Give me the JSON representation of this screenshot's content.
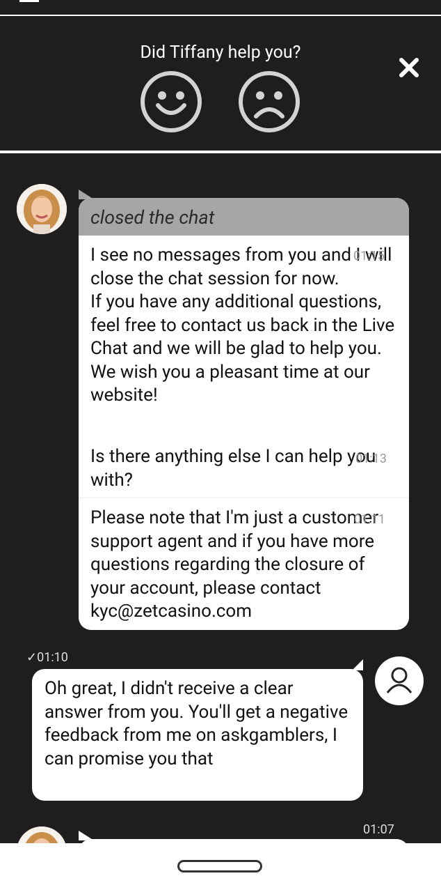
{
  "feedback": {
    "title": "Did Tiffany help you?",
    "close_icon": "close-icon",
    "happy_icon": "smiley-happy-icon",
    "sad_icon": "smiley-sad-icon"
  },
  "agent_thread": {
    "status": "closed the chat",
    "messages": [
      {
        "text": "I see no messages from you and I will close the chat session for now.\nIf you have any additional questions, feel free to contact us back in the Live Chat and we will be glad to help you.\nWe wish you a pleasant time at our website!",
        "time": "01:15"
      },
      {
        "text": "Is there anything else I can help you with?",
        "time": "01:13"
      },
      {
        "text": "Please note that I'm just a customer support agent and if you have more questions regarding the closure of your account, please contact kyc@zetcasino.com",
        "time": "01:11"
      }
    ]
  },
  "user_message": {
    "time": "✓01:10",
    "text": "Oh great, I didn't receive a clear answer from you. You'll get a negative feedback from me on askgamblers, I can promise you that"
  },
  "next_agent_message": {
    "time": "01:07"
  },
  "colors": {
    "background": "#1e1e1e",
    "closed_header": "#a6a6a6",
    "bubble": "#ffffff"
  }
}
